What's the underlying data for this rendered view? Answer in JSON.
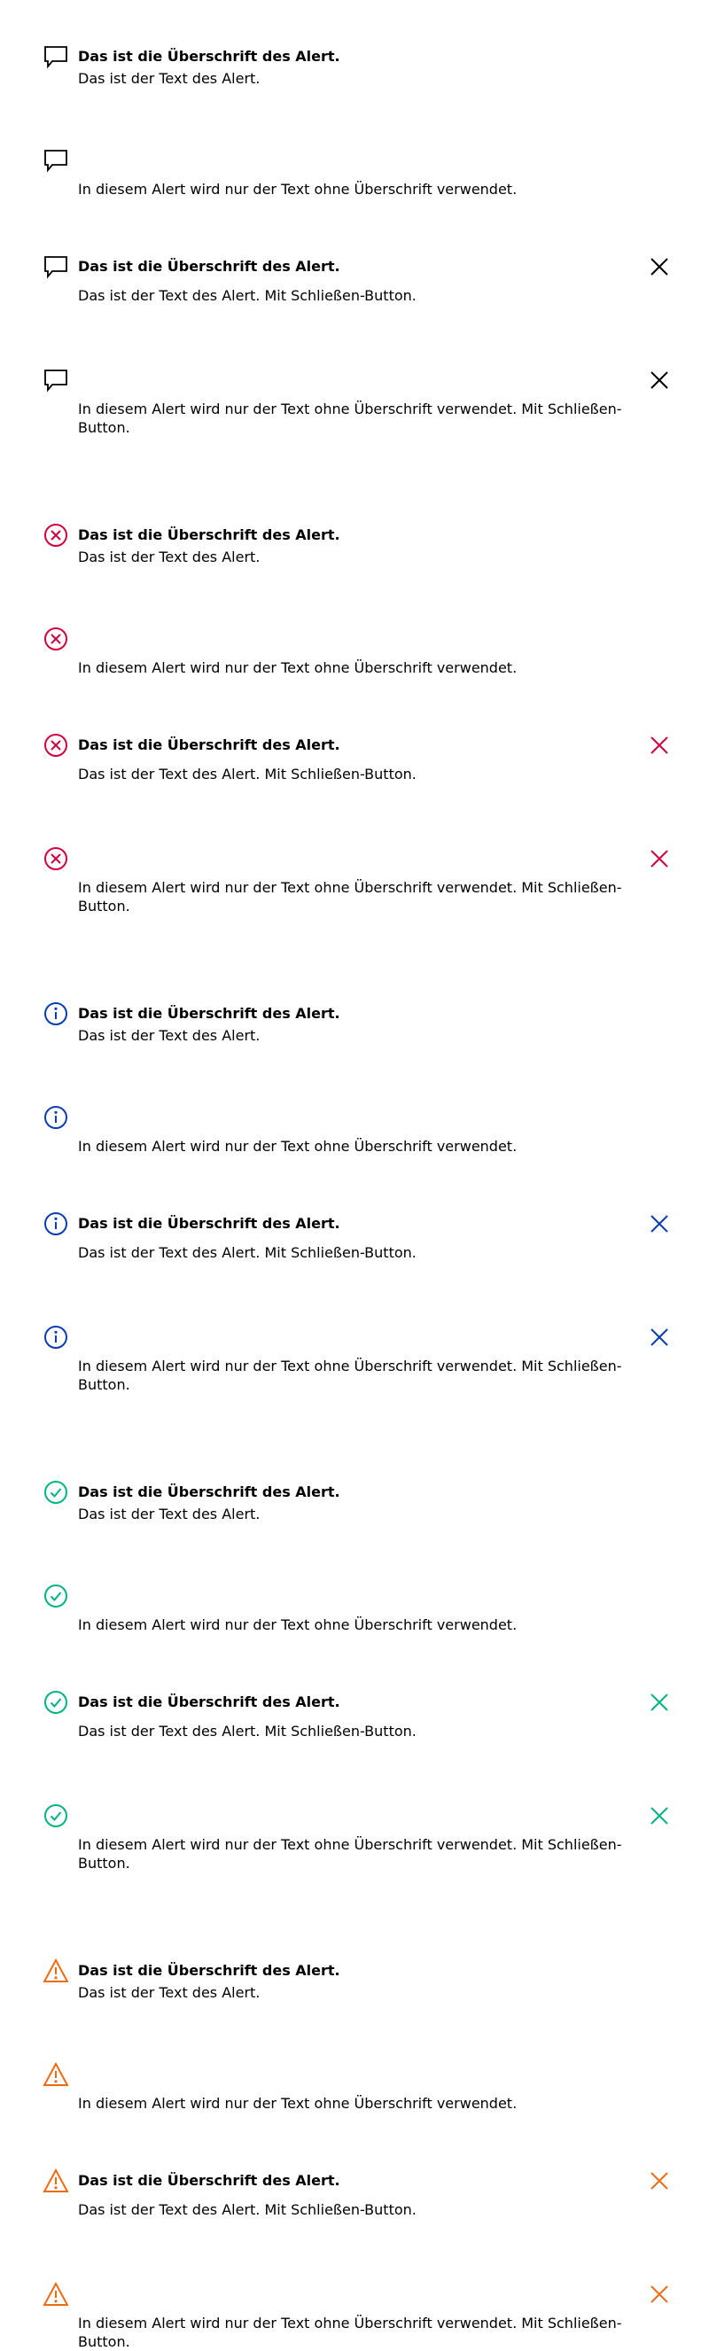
{
  "heading_text": "Das ist die Überschrift des Alert.",
  "body_text": "Das ist der Text des Alert.",
  "body_text_with_close": "Das ist der Text des Alert. Mit Schließen-Button.",
  "text_only": "In diesem Alert wird nur der Text ohne Überschrift verwendet.",
  "text_only_with_close": "In diesem Alert wird nur der Text ohne Überschrift verwendet. Mit Schließen-Button.",
  "close_label": "Schließen",
  "variants": [
    {
      "name": "default",
      "icon": "speech-bubble-icon",
      "color": "#000000"
    },
    {
      "name": "error",
      "icon": "error-circle-x-icon",
      "color": "#d2003c"
    },
    {
      "name": "info",
      "icon": "info-circle-icon",
      "color": "#0a3cb4"
    },
    {
      "name": "success",
      "icon": "check-circle-icon",
      "color": "#00b482"
    },
    {
      "name": "warning",
      "icon": "warning-triangle-icon",
      "color": "#ee6a13"
    }
  ]
}
